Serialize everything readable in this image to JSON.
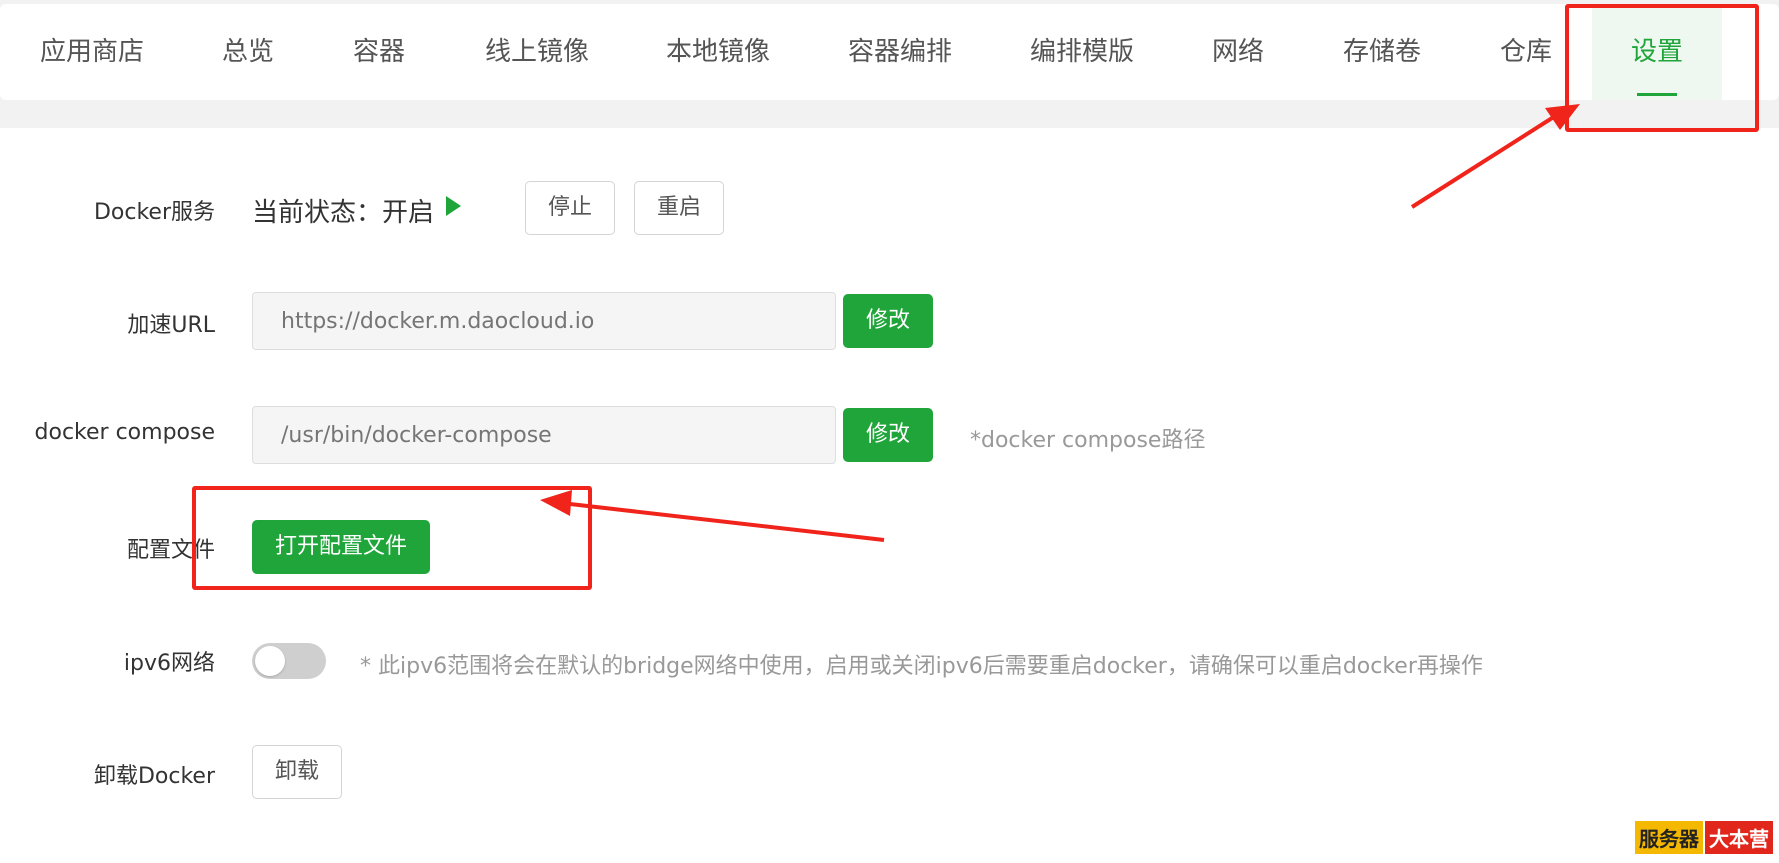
{
  "tabs": [
    {
      "label": "应用商店"
    },
    {
      "label": "总览"
    },
    {
      "label": "容器"
    },
    {
      "label": "线上镜像"
    },
    {
      "label": "本地镜像"
    },
    {
      "label": "容器编排"
    },
    {
      "label": "编排模版"
    },
    {
      "label": "网络"
    },
    {
      "label": "存储卷"
    },
    {
      "label": "仓库"
    },
    {
      "label": "设置",
      "active": true
    }
  ],
  "settings": {
    "docker_service": {
      "label": "Docker服务",
      "status": "当前状态：开启",
      "stop_label": "停止",
      "restart_label": "重启"
    },
    "mirror_url": {
      "label": "加速URL",
      "placeholder": "https://docker.m.daocloud.io",
      "modify_label": "修改"
    },
    "docker_compose": {
      "label": "docker compose",
      "placeholder": "/usr/bin/docker-compose",
      "modify_label": "修改",
      "hint": "*docker compose路径"
    },
    "config_file": {
      "label": "配置文件",
      "open_label": "打开配置文件"
    },
    "ipv6": {
      "label": "ipv6网络",
      "enabled": false,
      "hint": "* 此ipv6范围将会在默认的bridge网络中使用，启用或关闭ipv6后需要重启docker，请确保可以重启docker再操作"
    },
    "uninstall": {
      "label": "卸载Docker",
      "button_label": "卸载"
    }
  },
  "watermark": {
    "part1": "服务器",
    "part2": "大本营"
  },
  "colors": {
    "accent": "#20a53a",
    "annotation": "#f0241b"
  }
}
